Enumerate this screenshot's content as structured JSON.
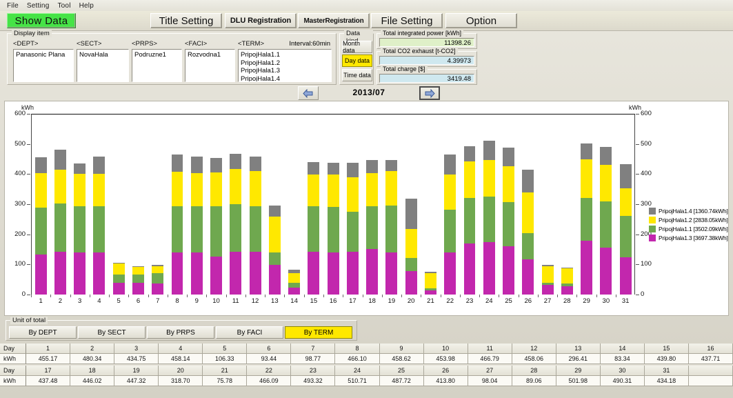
{
  "menubar": {
    "items": [
      {
        "label": "File"
      },
      {
        "label": "Setting"
      },
      {
        "label": "Tool"
      },
      {
        "label": "Help"
      }
    ]
  },
  "toolbar": {
    "show_data": "Show Data",
    "title_setting": "Title Setting",
    "dlu_registration": "DLU Registration",
    "master_registration": "MasterRegistration",
    "file_setting": "File Setting",
    "option": "Option"
  },
  "display_item": {
    "title": "Display item",
    "interval": "Interval:60min",
    "columns": [
      {
        "header": "<DEPT>",
        "values": [
          "Panasonic Plana"
        ]
      },
      {
        "header": "<SECT>",
        "values": [
          "NovaHala"
        ]
      },
      {
        "header": "<PRPS>",
        "values": [
          "Podruzne1"
        ]
      },
      {
        "header": "<FACI>",
        "values": [
          "Rozvodna1"
        ]
      },
      {
        "header": "<TERM>",
        "values": [
          "PripojHala1.1",
          "PripojHala1.2",
          "PripojHala1.3",
          "PripojHala1.4"
        ]
      }
    ]
  },
  "data_kind": {
    "title": "Data kind",
    "options": [
      "Month data",
      "Day data",
      "Time data"
    ],
    "selected": "Day data"
  },
  "totals": [
    {
      "label": "Total integrated power [kWh]",
      "value": "11398.26",
      "color": "#dff0c8"
    },
    {
      "label": "Total CO2 exhaust [t-CO2]",
      "value": "4.39973",
      "color": "#cfe8ef"
    },
    {
      "label": "Total charge [$]",
      "value": "3419.48",
      "color": "#cfe8ef"
    }
  ],
  "navigation": {
    "prev_icon": "left-arrow-icon",
    "next_icon": "right-arrow-icon",
    "period": "2013/07"
  },
  "unit_of_total": {
    "title": "Unit of total",
    "tabs": [
      "By DEPT",
      "By SECT",
      "By PRPS",
      "By FACI",
      "By TERM"
    ],
    "selected": "By TERM"
  },
  "table": {
    "row_labels": [
      "Day",
      "kWh"
    ],
    "block1_days": [
      "1",
      "2",
      "3",
      "4",
      "5",
      "6",
      "7",
      "8",
      "9",
      "10",
      "11",
      "12",
      "13",
      "14",
      "15",
      "16"
    ],
    "block1_values": [
      "455.17",
      "480.34",
      "434.75",
      "458.14",
      "106.33",
      "93.44",
      "98.77",
      "466.10",
      "458.62",
      "453.98",
      "466.79",
      "458.06",
      "296.41",
      "83.34",
      "439.80",
      "437.71"
    ],
    "block2_days": [
      "17",
      "18",
      "19",
      "20",
      "21",
      "22",
      "23",
      "24",
      "25",
      "26",
      "27",
      "28",
      "29",
      "30",
      "31",
      ""
    ],
    "block2_values": [
      "437.48",
      "446.02",
      "447.32",
      "318.70",
      "75.78",
      "466.09",
      "493.32",
      "510.71",
      "487.72",
      "413.80",
      "98.04",
      "89.06",
      "501.98",
      "490.31",
      "434.18",
      ""
    ]
  },
  "chart_data": {
    "type": "bar",
    "stacked": true,
    "title": "2013/07",
    "xlabel": "",
    "ylabel": "kWh",
    "ylim": [
      0,
      600
    ],
    "yticks": [
      0,
      100,
      200,
      300,
      400,
      500,
      600
    ],
    "grid": false,
    "legend_position": "right",
    "axis_unit_left": "kWh",
    "axis_unit_right": "kWh",
    "categories": [
      "1",
      "2",
      "3",
      "4",
      "5",
      "6",
      "7",
      "8",
      "9",
      "10",
      "11",
      "12",
      "13",
      "14",
      "15",
      "16",
      "17",
      "18",
      "19",
      "20",
      "21",
      "22",
      "23",
      "24",
      "25",
      "26",
      "27",
      "28",
      "29",
      "30",
      "31"
    ],
    "totals": [
      455.17,
      480.34,
      434.75,
      458.14,
      106.33,
      93.44,
      98.77,
      466.1,
      458.62,
      453.98,
      466.79,
      458.06,
      296.41,
      83.34,
      439.8,
      437.71,
      437.48,
      446.02,
      447.32,
      318.7,
      75.78,
      466.09,
      493.32,
      510.71,
      487.72,
      413.8,
      98.04,
      89.06,
      501.98,
      490.31,
      434.18
    ],
    "series": [
      {
        "name": "PripojHala1.3",
        "total": "3697.38",
        "color": "#c227ad",
        "legend": "PripojHala1.3 [3697.38kWh]",
        "values": [
          133,
          141,
          140,
          139,
          39,
          38,
          37,
          140,
          140,
          127,
          141,
          142,
          98,
          22,
          141,
          140,
          143,
          152,
          139,
          77,
          13,
          139,
          169,
          175,
          160,
          116,
          31,
          28,
          179,
          155,
          124
        ]
      },
      {
        "name": "PripojHala1.1",
        "total": "3502.09",
        "color": "#6fa84f",
        "legend": "PripojHala1.1 [3502.09kWh]",
        "values": [
          155,
          161,
          153,
          155,
          28,
          29,
          33,
          153,
          154,
          166,
          158,
          152,
          41,
          18,
          152,
          151,
          131,
          142,
          157,
          45,
          7,
          143,
          152,
          150,
          148,
          87,
          8,
          9,
          141,
          155,
          137
        ]
      },
      {
        "name": "PripojHala1.2",
        "total": "2838.05",
        "color": "#ffe800",
        "legend": "PripojHala1.2 [2838.05kWh]",
        "values": [
          116,
          113,
          108,
          107,
          37,
          25,
          25,
          114,
          109,
          112,
          117,
          117,
          120,
          31,
          105,
          108,
          115,
          110,
          114,
          95,
          51,
          116,
          122,
          122,
          118,
          135,
          56,
          50,
          130,
          120,
          91
        ]
      },
      {
        "name": "PripojHala1.4",
        "total": "1360.74",
        "color": "#808080",
        "legend": "PripojHala1.4 [1360.74kWh]",
        "values": [
          51,
          65,
          34,
          57,
          2,
          1,
          4,
          59,
          56,
          49,
          51,
          47,
          37,
          12,
          42,
          39,
          48,
          42,
          37,
          102,
          5,
          68,
          50,
          64,
          62,
          76,
          3,
          2,
          52,
          60,
          82
        ]
      }
    ]
  }
}
